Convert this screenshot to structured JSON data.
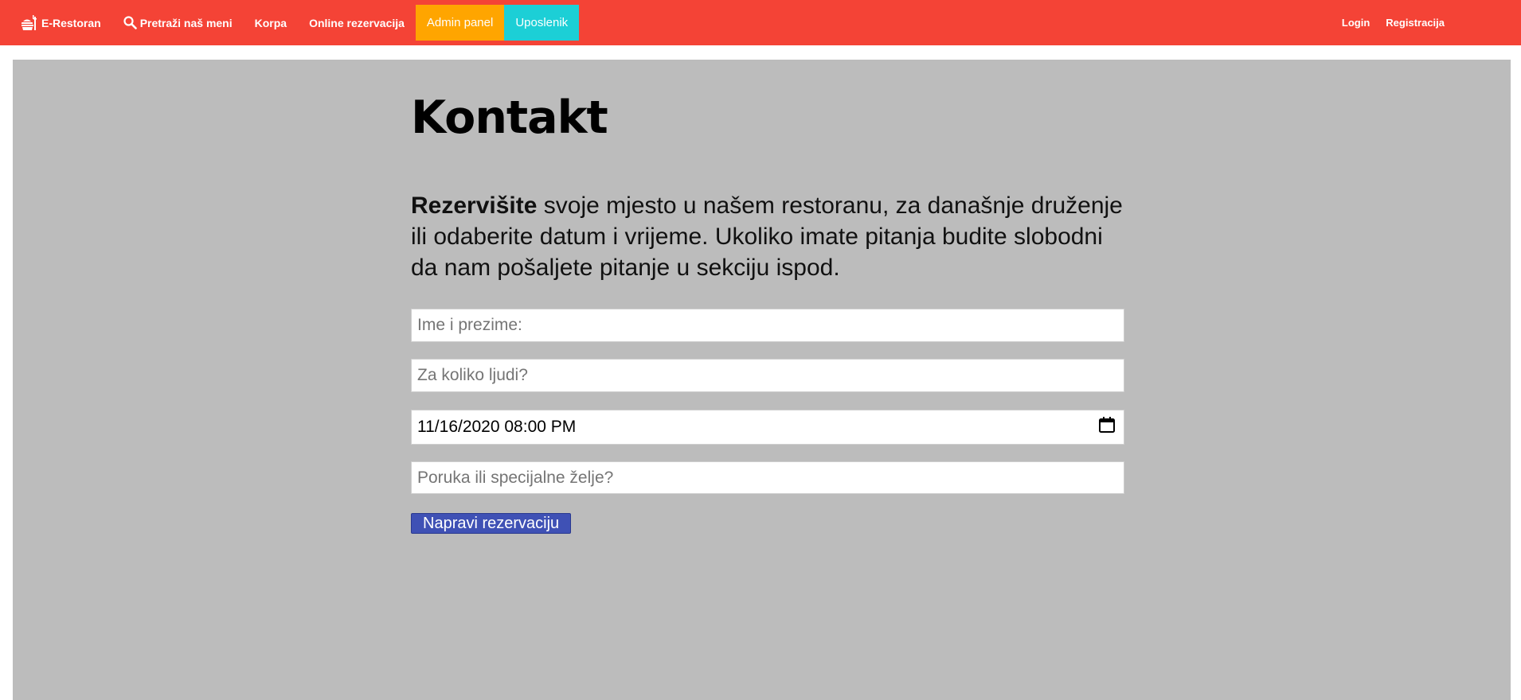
{
  "nav": {
    "brand": "E-Restoran",
    "search": "Pretraži naš meni",
    "cart": "Korpa",
    "online_reservation": "Online rezervacija",
    "admin_panel": "Admin panel",
    "employee": "Uposlenik",
    "login": "Login",
    "register": "Registracija",
    "colors": {
      "bar": "#f44336",
      "admin": "#ffa500",
      "employee": "#1ccfd6"
    },
    "icons": {
      "brand": "restaurant-icon",
      "search": "search-icon"
    }
  },
  "main": {
    "title": "Kontakt",
    "intro_bold": "Rezervišite",
    "intro_rest": " svoje mjesto u našem restoranu, za današnje druženje ili odaberite datum i vrijeme. Ukoliko imate pitanja budite slobodni da nam pošaljete pitanje u sekciju ispod.",
    "form": {
      "name_placeholder": "Ime i prezime:",
      "people_placeholder": "Za koliko ljudi?",
      "datetime_value": "11/16/2020 08:00 PM",
      "message_placeholder": "Poruka ili specijalne želje?",
      "submit_label": "Napravi rezervaciju"
    },
    "colors": {
      "background": "#bcbcbc",
      "button": "#3f51b5"
    }
  }
}
